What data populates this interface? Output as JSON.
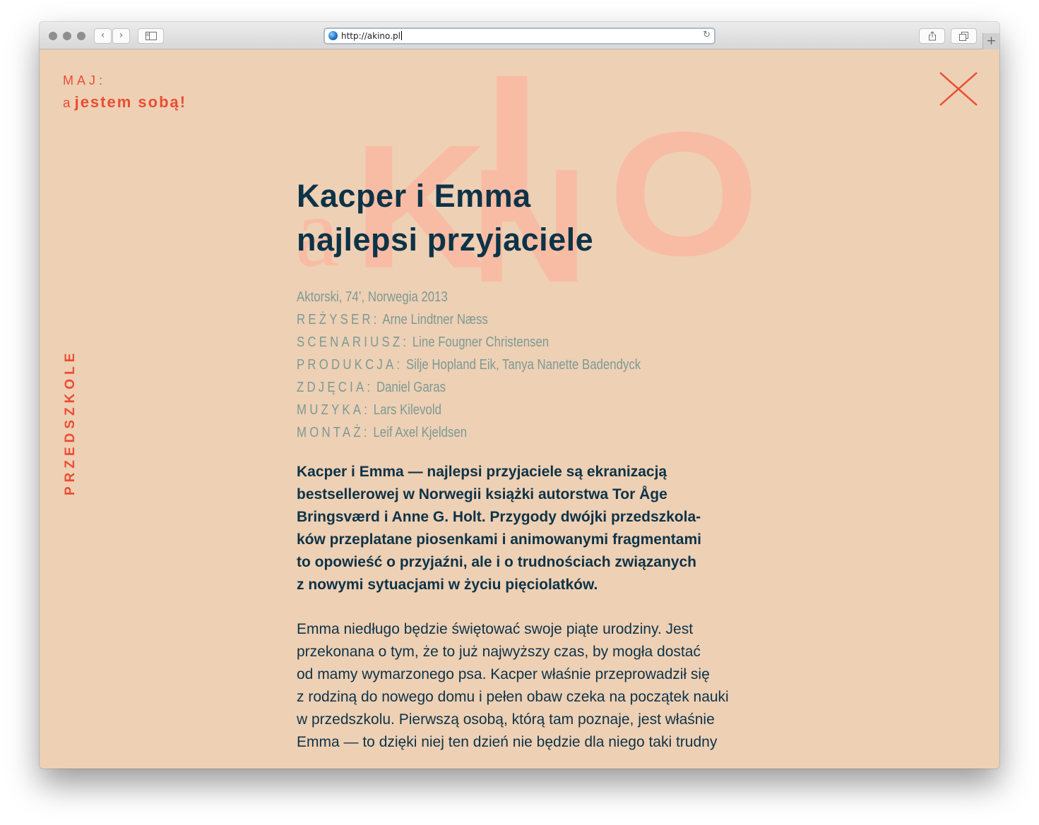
{
  "browser": {
    "url": "http://akino.pl"
  },
  "header": {
    "month": "MAJ:",
    "slogan_a": "a",
    "slogan_b": "jestem sobą!"
  },
  "logo": {
    "a": "a",
    "k": "K",
    "i": "I",
    "n": "N",
    "o": "O"
  },
  "sidebar": {
    "category": "PRZEDSZKOLE"
  },
  "film": {
    "title_line1": "Kacper i Emma",
    "title_line2": "najlepsi przyjaciele",
    "info": "Aktorski, 74’, Norwegia 2013",
    "credits": [
      {
        "label": "REŻYSER:",
        "value": "Arne Lindtner Næss"
      },
      {
        "label": "SCENARIUSZ:",
        "value": "Line Fougner Christensen"
      },
      {
        "label": "PRODUKCJA:",
        "value": "Silje Hopland Eik, Tanya Nanette Badendyck"
      },
      {
        "label": "ZDJĘCIA:",
        "value": "Daniel Garas"
      },
      {
        "label": "MUZYKA:",
        "value": "Lars Kilevold"
      },
      {
        "label": "MONTAŻ:",
        "value": "Leif Axel Kjeldsen"
      }
    ],
    "lead": "Kacper i Emma — najlepsi przyjaciele są ekranizacją\nbestsellerowej w Norwegii książki autorstwa Tor Åge\nBringsværd i Anne G. Holt. Przygody dwójki przedszkola-\nków przeplatane piosenkami i animowanymi fragmentami\nto opowieść o przyjaźni, ale i o trudnościach związanych\nz nowymi sytuacjami w życiu pięciolatków.",
    "description": "Emma niedługo będzie świętować swoje piąte urodziny. Jest\nprzekonana o tym, że to już najwyższy czas, by mogła dostać\nod mamy wymarzonego psa. Kacper właśnie przeprowadził się\nz rodziną do nowego domu i pełen obaw czeka na początek nauki\nw przedszkolu. Pierwszą osobą, którą tam poznaje, jest właśnie\nEmma — to dzięki niej ten dzień nie będzie dla niego taki trudny"
  },
  "colors": {
    "accent": "#ea4d33",
    "text": "#0d3347",
    "muted": "#7c9a94",
    "background": "#eed0b5",
    "logo": "#f8bca5"
  }
}
